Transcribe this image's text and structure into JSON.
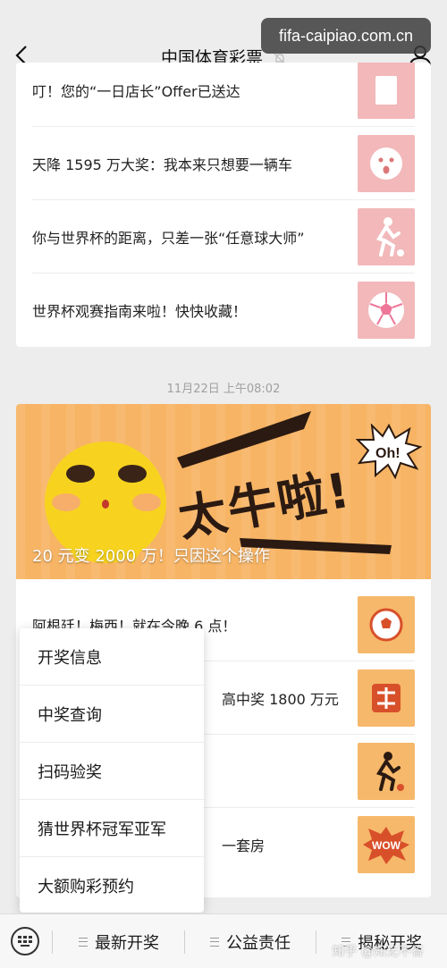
{
  "watermark": "fifa-caipiao.com.cn",
  "header": {
    "title": "中国体育彩票"
  },
  "card1": {
    "rows": [
      {
        "text": "叮！您的“一日店长”Offer已送达",
        "icon": "document-icon"
      },
      {
        "text": "天降 1595 万大奖：我本来只想要一辆车",
        "icon": "surprised-face-icon"
      },
      {
        "text": "你与世界杯的距离，只差一张“任意球大师”",
        "icon": "soccer-player-icon"
      },
      {
        "text": "世界杯观赛指南来啦！快快收藏！",
        "icon": "soccer-ball-icon"
      }
    ]
  },
  "timestamp": "11月22日 上午08:02",
  "card2": {
    "banner": {
      "headline": "太牛啦!",
      "exclaim": "Oh!",
      "caption": "20 元变 2000 万！只因这个操作"
    },
    "rows": [
      {
        "text": "阿根廷！梅西！就在今晚 6 点！",
        "icon": "soccer-ball-icon"
      },
      {
        "text": "高中奖 1800 万元",
        "icon": "jiang-icon"
      },
      {
        "text": "",
        "icon": "soccer-player-icon"
      },
      {
        "text": "一套房",
        "icon": "wow-icon"
      }
    ]
  },
  "menu": {
    "items": [
      "开奖信息",
      "中奖查询",
      "扫码验奖",
      "猜世界杯冠军亚军",
      "大额购彩预约"
    ]
  },
  "bottom_bar": {
    "tabs": [
      "最新开奖",
      "公益责任",
      "揭秘开奖"
    ]
  },
  "credit": "知乎 @知无不答",
  "colors": {
    "accent_pink": "#f2b8ba",
    "accent_orange": "#f6b86a",
    "banner": "#f7b464"
  }
}
